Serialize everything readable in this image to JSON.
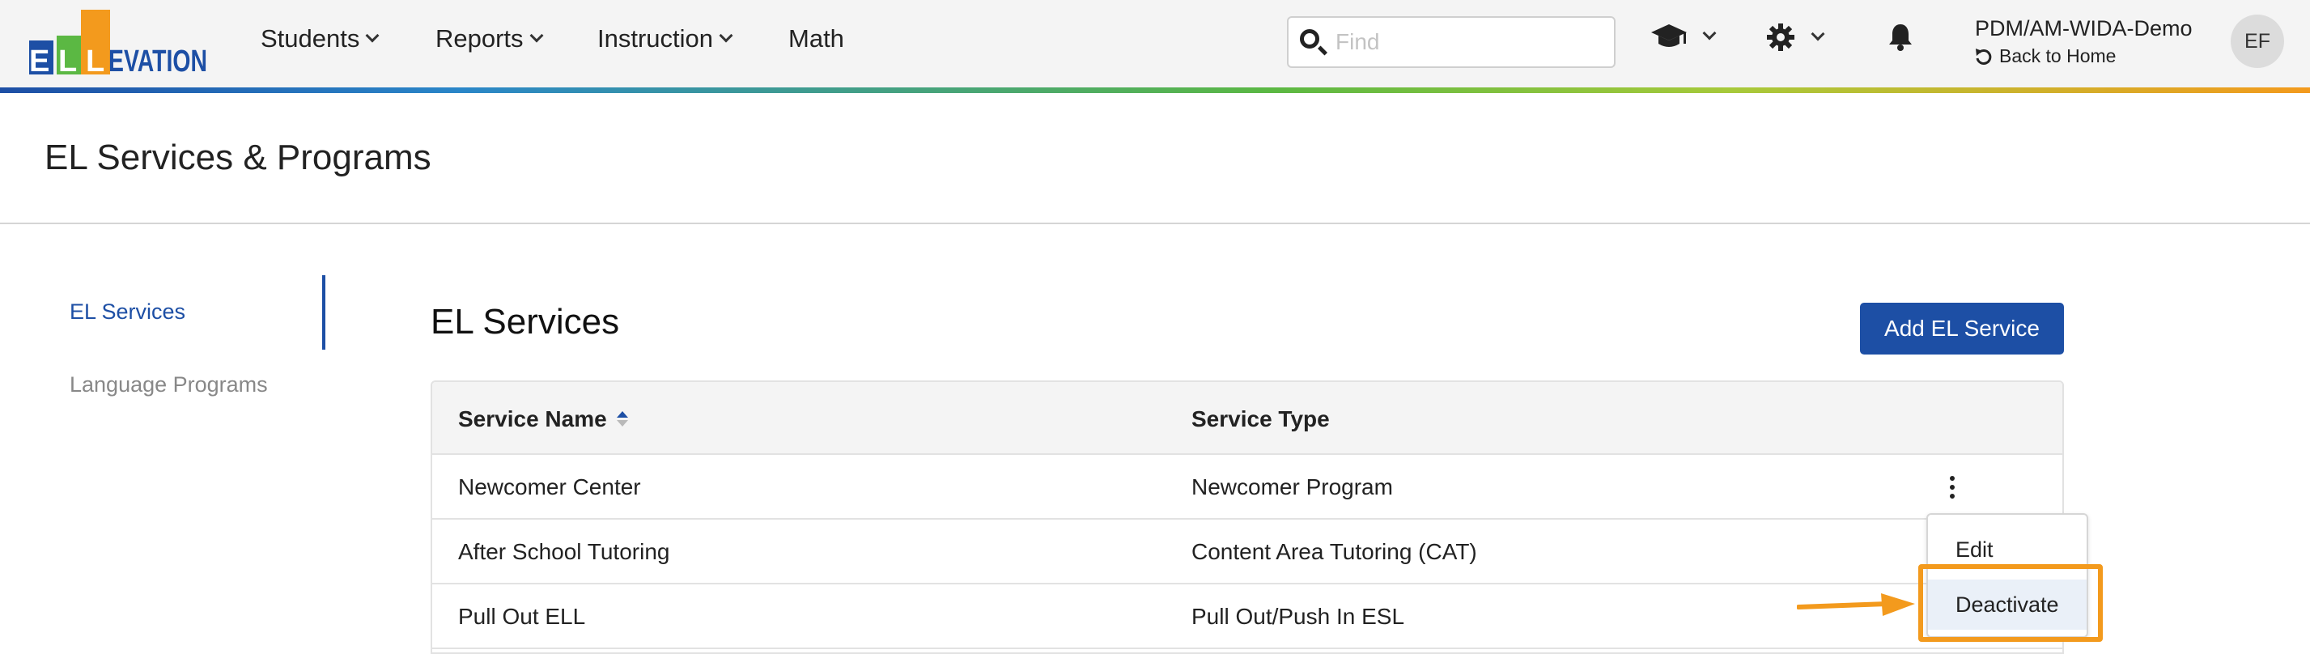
{
  "brand": {
    "logo_text": "ELLEVATION",
    "accent": "#1d4fa5",
    "orange": "#f39a1d",
    "green": "#5bb843"
  },
  "nav": {
    "items": [
      {
        "label": "Students",
        "has_dropdown": true
      },
      {
        "label": "Reports",
        "has_dropdown": true
      },
      {
        "label": "Instruction",
        "has_dropdown": true
      },
      {
        "label": "Math",
        "has_dropdown": false
      }
    ],
    "search_placeholder": "Find",
    "icons": [
      "graduation-cap-icon",
      "gear-icon",
      "bell-icon"
    ],
    "org_name": "PDM/AM-WIDA-Demo",
    "back_home_label": "Back to Home",
    "avatar_initials": "EF"
  },
  "page": {
    "title": "EL Services & Programs"
  },
  "sidebar": {
    "items": [
      {
        "label": "EL Services",
        "active": true
      },
      {
        "label": "Language Programs",
        "active": false
      }
    ]
  },
  "main": {
    "section_title": "EL Services",
    "add_button_label": "Add EL Service",
    "table": {
      "columns": [
        "Service Name",
        "Service Type"
      ],
      "sort_column": "Service Name",
      "rows": [
        {
          "name": "Newcomer Center",
          "type": "Newcomer Program"
        },
        {
          "name": "After School Tutoring",
          "type": "Content Area Tutoring (CAT)"
        },
        {
          "name": "Pull Out ELL",
          "type": "Pull Out/Push In ESL"
        }
      ]
    },
    "row_menu": {
      "items": [
        "Edit",
        "Deactivate"
      ],
      "highlighted": "Deactivate"
    }
  }
}
